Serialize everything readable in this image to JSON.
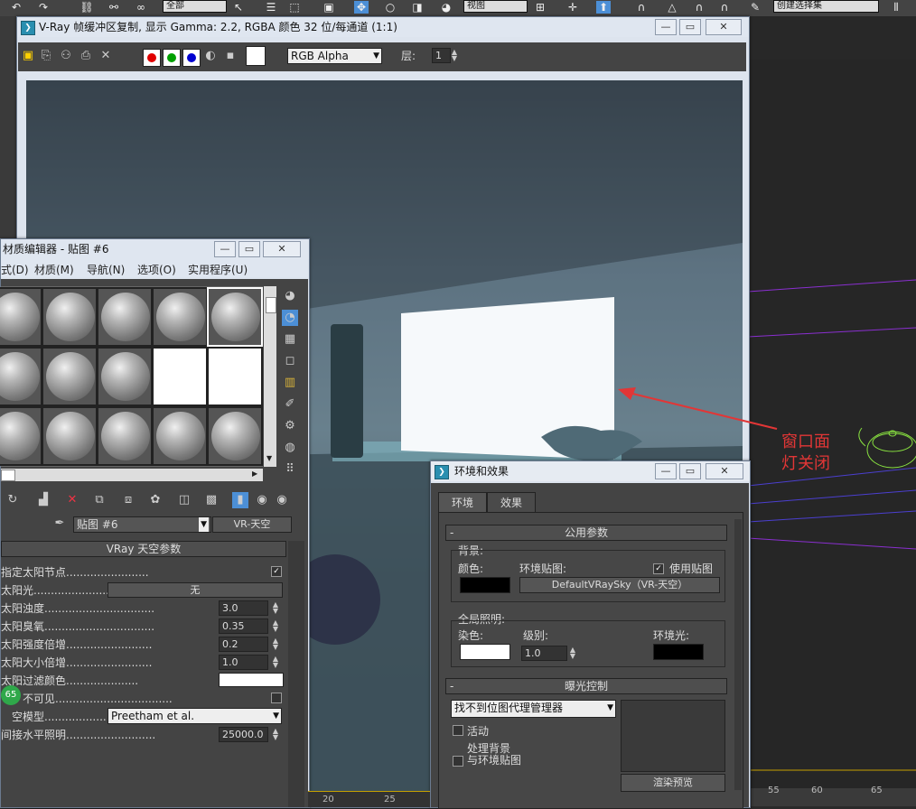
{
  "toolbar": {
    "selection_filter": "全部",
    "view_dropdown": "视图",
    "named_selection": "创建选择集",
    "icons": [
      "undo-icon",
      "redo-icon",
      "link-icon",
      "unlink-icon",
      "bind-icon",
      "select-icon",
      "select-name-icon",
      "rect-select-icon",
      "window-cross-icon",
      "move-icon",
      "rotate-icon",
      "scale-icon",
      "ref-coord-icon",
      "pivot-icon",
      "manipulate-icon",
      "snap-icon",
      "angle-snap-icon",
      "percent-snap-icon",
      "spinner-snap-icon",
      "edit-named-icon",
      "mirror-icon",
      "align-icon"
    ]
  },
  "vray_window": {
    "title": "V-Ray 帧缓冲区复制, 显示 Gamma: 2.2, RGBA 颜色 32 位/每通道 (1:1)",
    "channel": "RGB Alpha",
    "layer_label": "层:",
    "layer_value": "1",
    "colors": {
      "red": "#e00000",
      "green": "#00a000",
      "blue": "#0000d0"
    }
  },
  "annotation": {
    "line1": "窗口面",
    "line2": "灯关闭",
    "color": "#e23636"
  },
  "material_editor": {
    "title": "材质编辑器 - 贴图 #6",
    "menu": [
      "式(D)",
      "材质(M)",
      "导航(N)",
      "选项(O)",
      "实用程序(U)"
    ],
    "map_name": "贴图 #6",
    "map_type": "VR-天空",
    "rollout_title": "VRay 天空参数",
    "params": {
      "sun_node_label": "指定太阳节点",
      "sun_light_label": "太阳光",
      "sun_light_value": "无",
      "turbidity_label": "太阳浊度",
      "turbidity_value": "3.0",
      "ozone_label": "太阳臭氧",
      "ozone_value": "0.35",
      "intensity_label": "太阳强度倍增",
      "intensity_value": "0.2",
      "size_label": "太阳大小倍增",
      "size_value": "1.0",
      "filter_color_label": "太阳过滤颜色",
      "invisible_label": "不可见",
      "sky_model_label": "空模型",
      "sky_model_value": "Preetham et al.",
      "horizon_label": "间接水平照明",
      "horizon_value": "25000.0"
    },
    "badge": "65"
  },
  "env_window": {
    "title": "环境和效果",
    "tabs": [
      "环境",
      "效果"
    ],
    "common_params": "公用参数",
    "background_label": "背景:",
    "color_label": "颜色:",
    "env_map_label": "环境贴图:",
    "use_map_label": "使用贴图",
    "env_map_button": "DefaultVRaySky（VR-天空）",
    "gi_label": "全局照明:",
    "tint_label": "染色:",
    "level_label": "级别:",
    "level_value": "1.0",
    "ambient_label": "环境光:",
    "exposure_title": "曝光控制",
    "exposure_dropdown": "找不到位图代理管理器",
    "active_label": "活动",
    "process_bg_label1": "处理背景",
    "process_bg_label2": "与环境贴图",
    "render_preview": "渲染预览"
  },
  "timeline": {
    "ticks": [
      "20",
      "25",
      "55",
      "60",
      "65"
    ]
  }
}
